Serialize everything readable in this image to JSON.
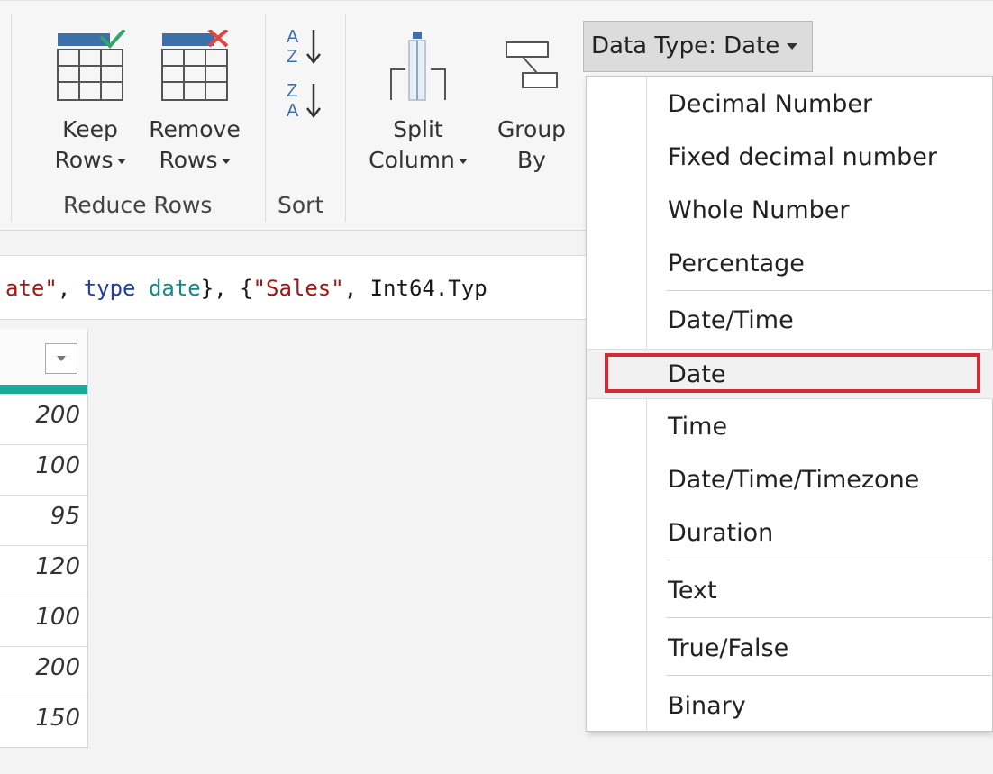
{
  "ribbon": {
    "keep_rows": {
      "line1": "Keep",
      "line2": "Rows"
    },
    "remove_rows": {
      "line1": "Remove",
      "line2": "Rows"
    },
    "reduce_rows_label": "Reduce Rows",
    "sort_label": "Sort",
    "split_column": {
      "line1": "Split",
      "line2": "Column"
    },
    "group_by": {
      "line1": "Group",
      "line2": "By"
    },
    "data_type_button": "Data Type: Date",
    "icons": {
      "keep_rows": "keep-rows-icon",
      "remove_rows": "remove-rows-icon",
      "sort_asc": "sort-ascending-icon",
      "sort_desc": "sort-descending-icon",
      "split_column": "split-column-icon",
      "group_by": "group-by-icon"
    }
  },
  "formula": {
    "tokens": [
      {
        "text": "ate\"",
        "kind": "str"
      },
      {
        "text": ", ",
        "kind": "plain"
      },
      {
        "text": "type",
        "kind": "kw"
      },
      {
        "text": " ",
        "kind": "plain"
      },
      {
        "text": "date",
        "kind": "type"
      },
      {
        "text": "}, {",
        "kind": "plain"
      },
      {
        "text": "\"Sales\"",
        "kind": "str"
      },
      {
        "text": ", Int64.Typ",
        "kind": "plain"
      }
    ]
  },
  "grid": {
    "values": [
      "200",
      "100",
      "95",
      "120",
      "100",
      "200",
      "150"
    ]
  },
  "menu": {
    "items": [
      {
        "label": "Decimal Number"
      },
      {
        "label": "Fixed decimal number"
      },
      {
        "label": "Whole Number"
      },
      {
        "label": "Percentage"
      },
      {
        "label": "Date/Time"
      },
      {
        "label": "Date"
      },
      {
        "label": "Time"
      },
      {
        "label": "Date/Time/Timezone"
      },
      {
        "label": "Duration"
      },
      {
        "label": "Text"
      },
      {
        "label": "True/False"
      },
      {
        "label": "Binary"
      }
    ],
    "selected": "Date"
  },
  "colors": {
    "accent_teal": "#1ea99a",
    "highlight_red": "#d42a35",
    "check_green": "#2fa66a",
    "remove_red": "#e0463d",
    "header_blue": "#3f6fa8"
  }
}
